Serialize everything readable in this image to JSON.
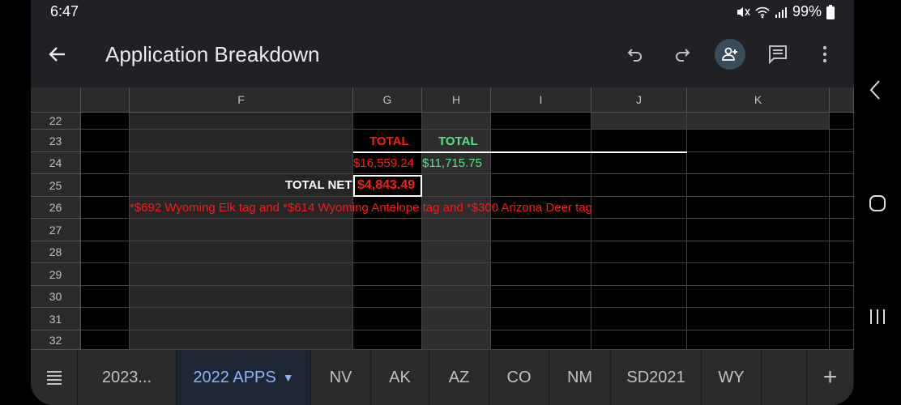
{
  "status": {
    "time": "6:47",
    "battery": "99%"
  },
  "app_bar": {
    "title": "Application Breakdown"
  },
  "columns": [
    "F",
    "G",
    "H",
    "I",
    "J",
    "K"
  ],
  "rows": [
    "22",
    "23",
    "24",
    "25",
    "26",
    "27",
    "28",
    "29",
    "30",
    "31",
    "32"
  ],
  "cells": {
    "g23": "TOTAL",
    "h23": "TOTAL",
    "g24": "$16,559.24",
    "h24": "$11,715.75",
    "f25": "TOTAL NET",
    "g25": "$4,843.49",
    "f26": "*$692 Wyoming Elk tag and *$614 Wyoming Antelope tag and *$300 Arizona Deer tag"
  },
  "tabs": [
    {
      "label": "2023..."
    },
    {
      "label": "2022 APPS",
      "active": true
    },
    {
      "label": "NV"
    },
    {
      "label": "AK"
    },
    {
      "label": "AZ"
    },
    {
      "label": "CO"
    },
    {
      "label": "NM"
    },
    {
      "label": "SD2021"
    },
    {
      "label": "WY"
    }
  ],
  "colors": {
    "accent": "#8ab4f8",
    "negative": "#ff1a1a",
    "positive": "#57e389"
  }
}
